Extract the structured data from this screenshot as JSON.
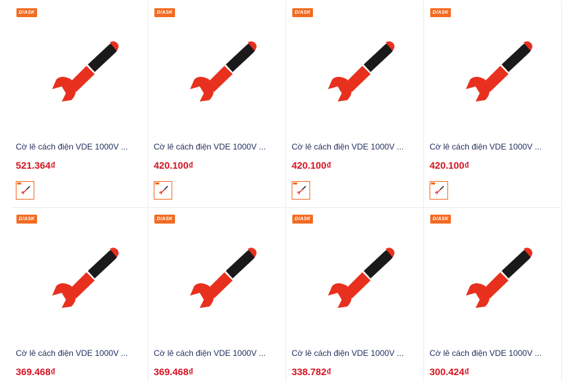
{
  "brand_label": "D/ASK",
  "colors": {
    "accent": "#f26b21",
    "price": "#d4111e",
    "title": "#1f2d5c",
    "wrench_red": "#e8301f",
    "handle_black": "#1a1a1a"
  },
  "products": [
    {
      "name": "Cờ lê cách điện VDE 1000V ...",
      "price": "521.364₫",
      "icon": "wrench-icon"
    },
    {
      "name": "Cờ lê cách điện VDE 1000V ...",
      "price": "420.100₫",
      "icon": "wrench-icon"
    },
    {
      "name": "Cờ lê cách điện VDE 1000V ...",
      "price": "420.100₫",
      "icon": "wrench-icon"
    },
    {
      "name": "Cờ lê cách điện VDE 1000V ...",
      "price": "420.100₫",
      "icon": "wrench-icon"
    },
    {
      "name": "Cờ lê cách điện VDE 1000V ...",
      "price": "369.468₫",
      "icon": "wrench-icon"
    },
    {
      "name": "Cờ lê cách điện VDE 1000V ...",
      "price": "369.468₫",
      "icon": "wrench-icon"
    },
    {
      "name": "Cờ lê cách điện VDE 1000V ...",
      "price": "338.782₫",
      "icon": "wrench-icon"
    },
    {
      "name": "Cờ lê cách điện VDE 1000V ...",
      "price": "300.424₫",
      "icon": "wrench-icon"
    }
  ]
}
